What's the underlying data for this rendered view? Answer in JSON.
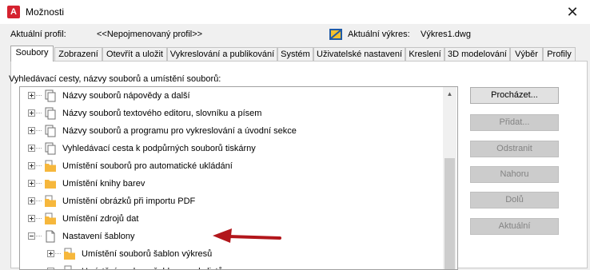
{
  "window": {
    "title": "Možnosti",
    "app_icon_letter": "A",
    "close_symbol": "✕"
  },
  "profile": {
    "label": "Aktuální profil:",
    "value": "<<Nepojmenovaný profil>>",
    "drawing_label": "Aktuální výkres:",
    "drawing_value": "Výkres1.dwg"
  },
  "tabs": [
    {
      "label": "Soubory",
      "active": true
    },
    {
      "label": "Zobrazení",
      "active": false
    },
    {
      "label": "Otevřít a uložit",
      "active": false
    },
    {
      "label": "Vykreslování a publikování",
      "active": false
    },
    {
      "label": "Systém",
      "active": false
    },
    {
      "label": "Uživatelské nastavení",
      "active": false
    },
    {
      "label": "Kreslení",
      "active": false
    },
    {
      "label": "3D modelování",
      "active": false
    },
    {
      "label": "Výběr",
      "active": false
    },
    {
      "label": "Profily",
      "active": false
    }
  ],
  "panel": {
    "heading": "Vyhledávací cesty, názvy souborů a umístění souborů:"
  },
  "tree": [
    {
      "label": "Názvy souborů nápovědy a další",
      "icon": "pages-icon",
      "expander": "plus"
    },
    {
      "label": "Názvy souborů textového editoru, slovníku a písem",
      "icon": "pages-icon",
      "expander": "plus"
    },
    {
      "label": "Názvy souborů a programu pro vykreslování a úvodní sekce",
      "icon": "pages-icon",
      "expander": "plus"
    },
    {
      "label": "Vyhledávací cesta k podpůrných souborů tiskárny",
      "icon": "pages-icon",
      "expander": "plus"
    },
    {
      "label": "Umístění souborů pro automatické ukládání",
      "icon": "folder-icon",
      "expander": "plus"
    },
    {
      "label": "Umístění knihy barev",
      "icon": "folder-icon",
      "expander": "plus"
    },
    {
      "label": "Umístění obrázků při importu PDF",
      "icon": "folder-icon",
      "expander": "plus"
    },
    {
      "label": "Umístění zdrojů dat",
      "icon": "folder-icon",
      "expander": "plus"
    },
    {
      "label": "Nastavení šablony",
      "icon": "page-icon",
      "expander": "minus"
    },
    {
      "label": "Umístění souborů šablon výkresů",
      "icon": "folder-icon",
      "expander": "plus"
    },
    {
      "label": "Umístění souboru šablony sady listů",
      "icon": "folder-icon",
      "expander": "plus"
    }
  ],
  "buttons": [
    {
      "label": "Procházet...",
      "enabled": true
    },
    {
      "label": "Přidat...",
      "enabled": false
    },
    {
      "label": "Odstranit",
      "enabled": false
    },
    {
      "label": "Nahoru",
      "enabled": false
    },
    {
      "label": "Dolů",
      "enabled": false
    },
    {
      "label": "Aktuální",
      "enabled": false
    }
  ],
  "colors": {
    "annotation_arrow": "#b2161b",
    "folder": "#f6b73c",
    "app_icon": "#d5222f"
  }
}
